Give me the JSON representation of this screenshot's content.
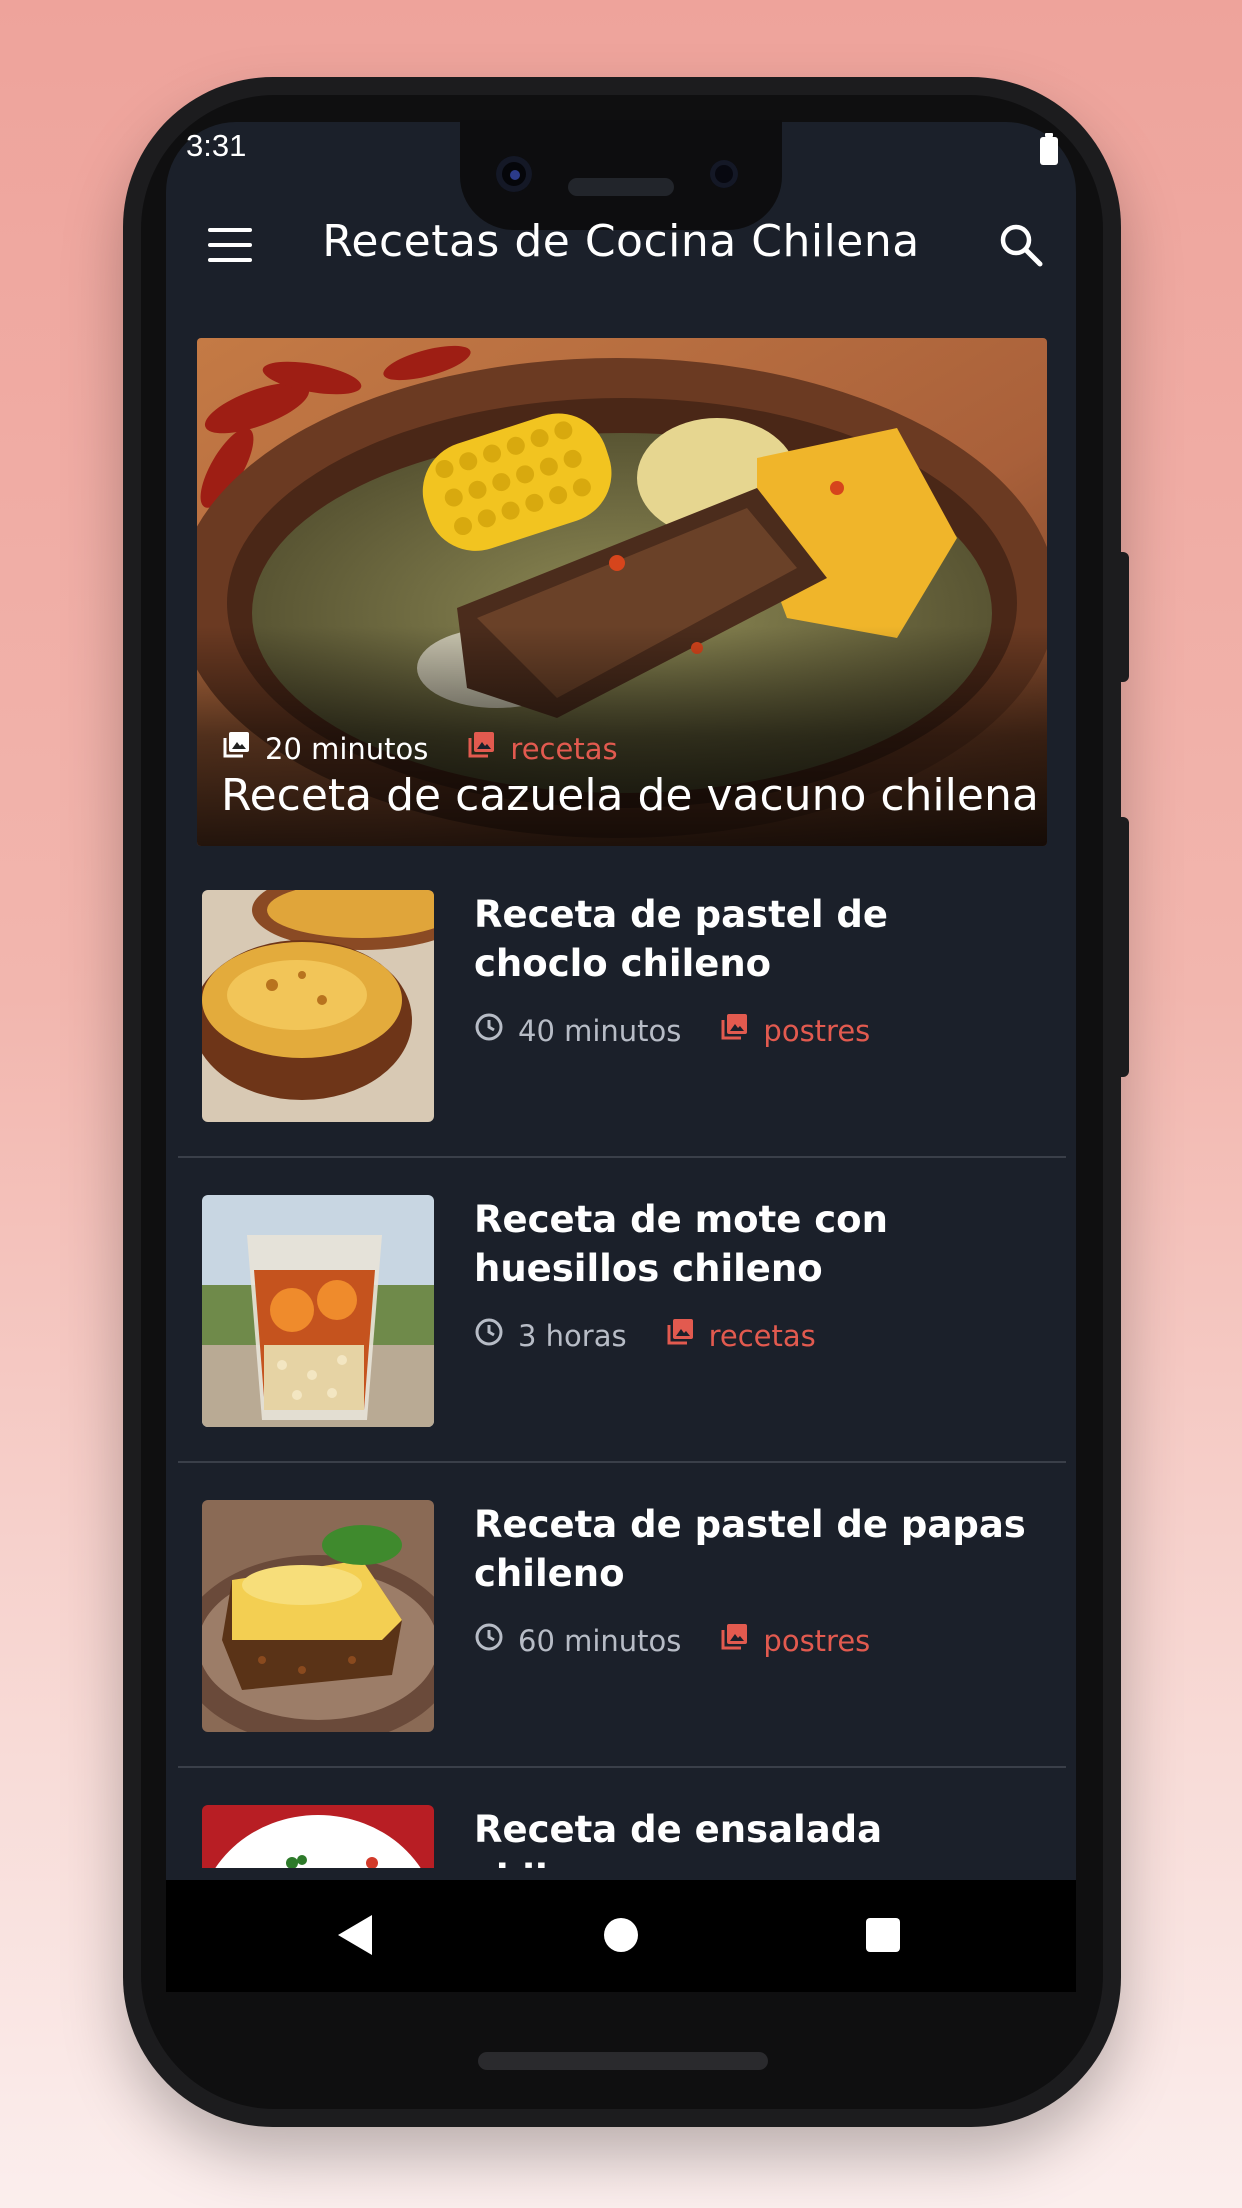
{
  "status_bar": {
    "time": "3:31"
  },
  "app_bar": {
    "title": "Recetas de Cocina Chilena",
    "menu_icon": "hamburger-menu-icon",
    "search_icon": "search-icon"
  },
  "featured": {
    "time": "20 minutos",
    "category": "recetas",
    "title": "Receta de cazuela de vacuno chilena",
    "time_icon": "image-icon",
    "category_icon": "image-icon"
  },
  "recipes": [
    {
      "title": "Receta de pastel de choclo chileno",
      "time": "40 minutos",
      "category": "postres",
      "time_icon": "clock-icon",
      "category_icon": "image-icon"
    },
    {
      "title": "Receta de mote con huesillos chileno",
      "time": "3 horas",
      "category": "recetas",
      "time_icon": "clock-icon",
      "category_icon": "image-icon"
    },
    {
      "title": "Receta de pastel de papas chileno",
      "time": "60 minutos",
      "category": "postres",
      "time_icon": "clock-icon",
      "category_icon": "image-icon"
    },
    {
      "title": "Receta de ensalada chilena",
      "time": "",
      "category": "",
      "time_icon": "clock-icon",
      "category_icon": "image-icon"
    }
  ],
  "colors": {
    "background": "#1b202a",
    "accent": "#e25a4f",
    "meta_text": "#b7bcc6",
    "divider": "#3a3f49"
  },
  "nav_bar": {
    "back_icon": "back-triangle-icon",
    "home_icon": "home-circle-icon",
    "recents_icon": "recents-square-icon"
  }
}
